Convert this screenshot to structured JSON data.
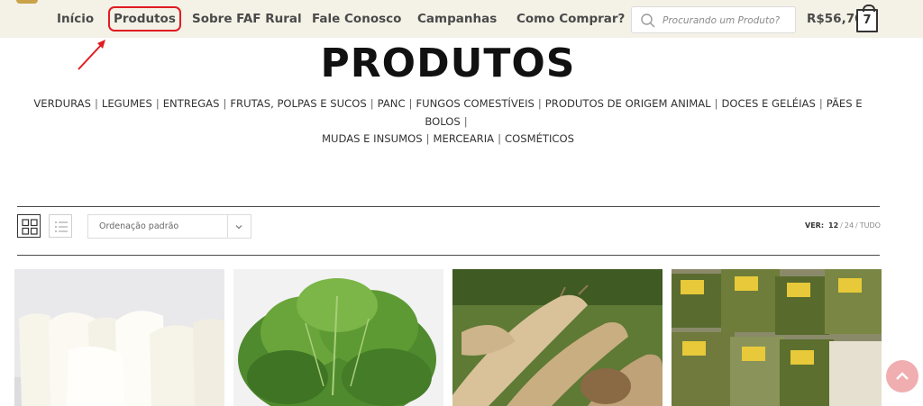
{
  "nav": {
    "items": [
      {
        "label": "Início"
      },
      {
        "label": "Produtos"
      },
      {
        "label": "Sobre FAF Rural"
      },
      {
        "label": "Fale Conosco"
      },
      {
        "label": "Campanhas"
      },
      {
        "label": "Como Comprar?"
      }
    ],
    "highlighted_item": "Produtos"
  },
  "search": {
    "placeholder": "Procurando um Produto?",
    "icon": "search-icon"
  },
  "cart": {
    "total": "R$56,70",
    "count": "7",
    "icon": "shopping-bag-icon"
  },
  "page": {
    "title": "PRODUTOS",
    "categories": [
      "VERDURAS",
      "LEGUMES",
      "ENTREGAS",
      "FRUTAS, POLPAS E SUCOS",
      "PANC",
      "FUNGOS COMESTÍVEIS",
      "PRODUTOS DE ORIGEM ANIMAL",
      "DOCES E GELÉIAS",
      "PÃES E BOLOS",
      "MUDAS E INSUMOS",
      "MERCEARIA",
      "COSMÉTICOS"
    ]
  },
  "toolbar": {
    "grid_view_icon": "grid-view-icon",
    "list_view_icon": "list-view-icon",
    "orderby_selected": "Ordenação padrão",
    "orderby_icon": "chevron-down-icon",
    "ver_label": "VER:",
    "ver_options": [
      "12",
      "24",
      "TUDO"
    ],
    "ver_current": "12"
  },
  "products": [
    {
      "image": "cheese-photo"
    },
    {
      "image": "lettuce-photo"
    },
    {
      "image": "root-vegetable-photo"
    },
    {
      "image": "packaged-herbs-photo"
    }
  ],
  "colors": {
    "topbar_bg": "#f4f1e6",
    "highlight": "#e11b22",
    "scroll_top": "#f0aeb0"
  },
  "scroll_top_icon": "chevron-up-icon"
}
